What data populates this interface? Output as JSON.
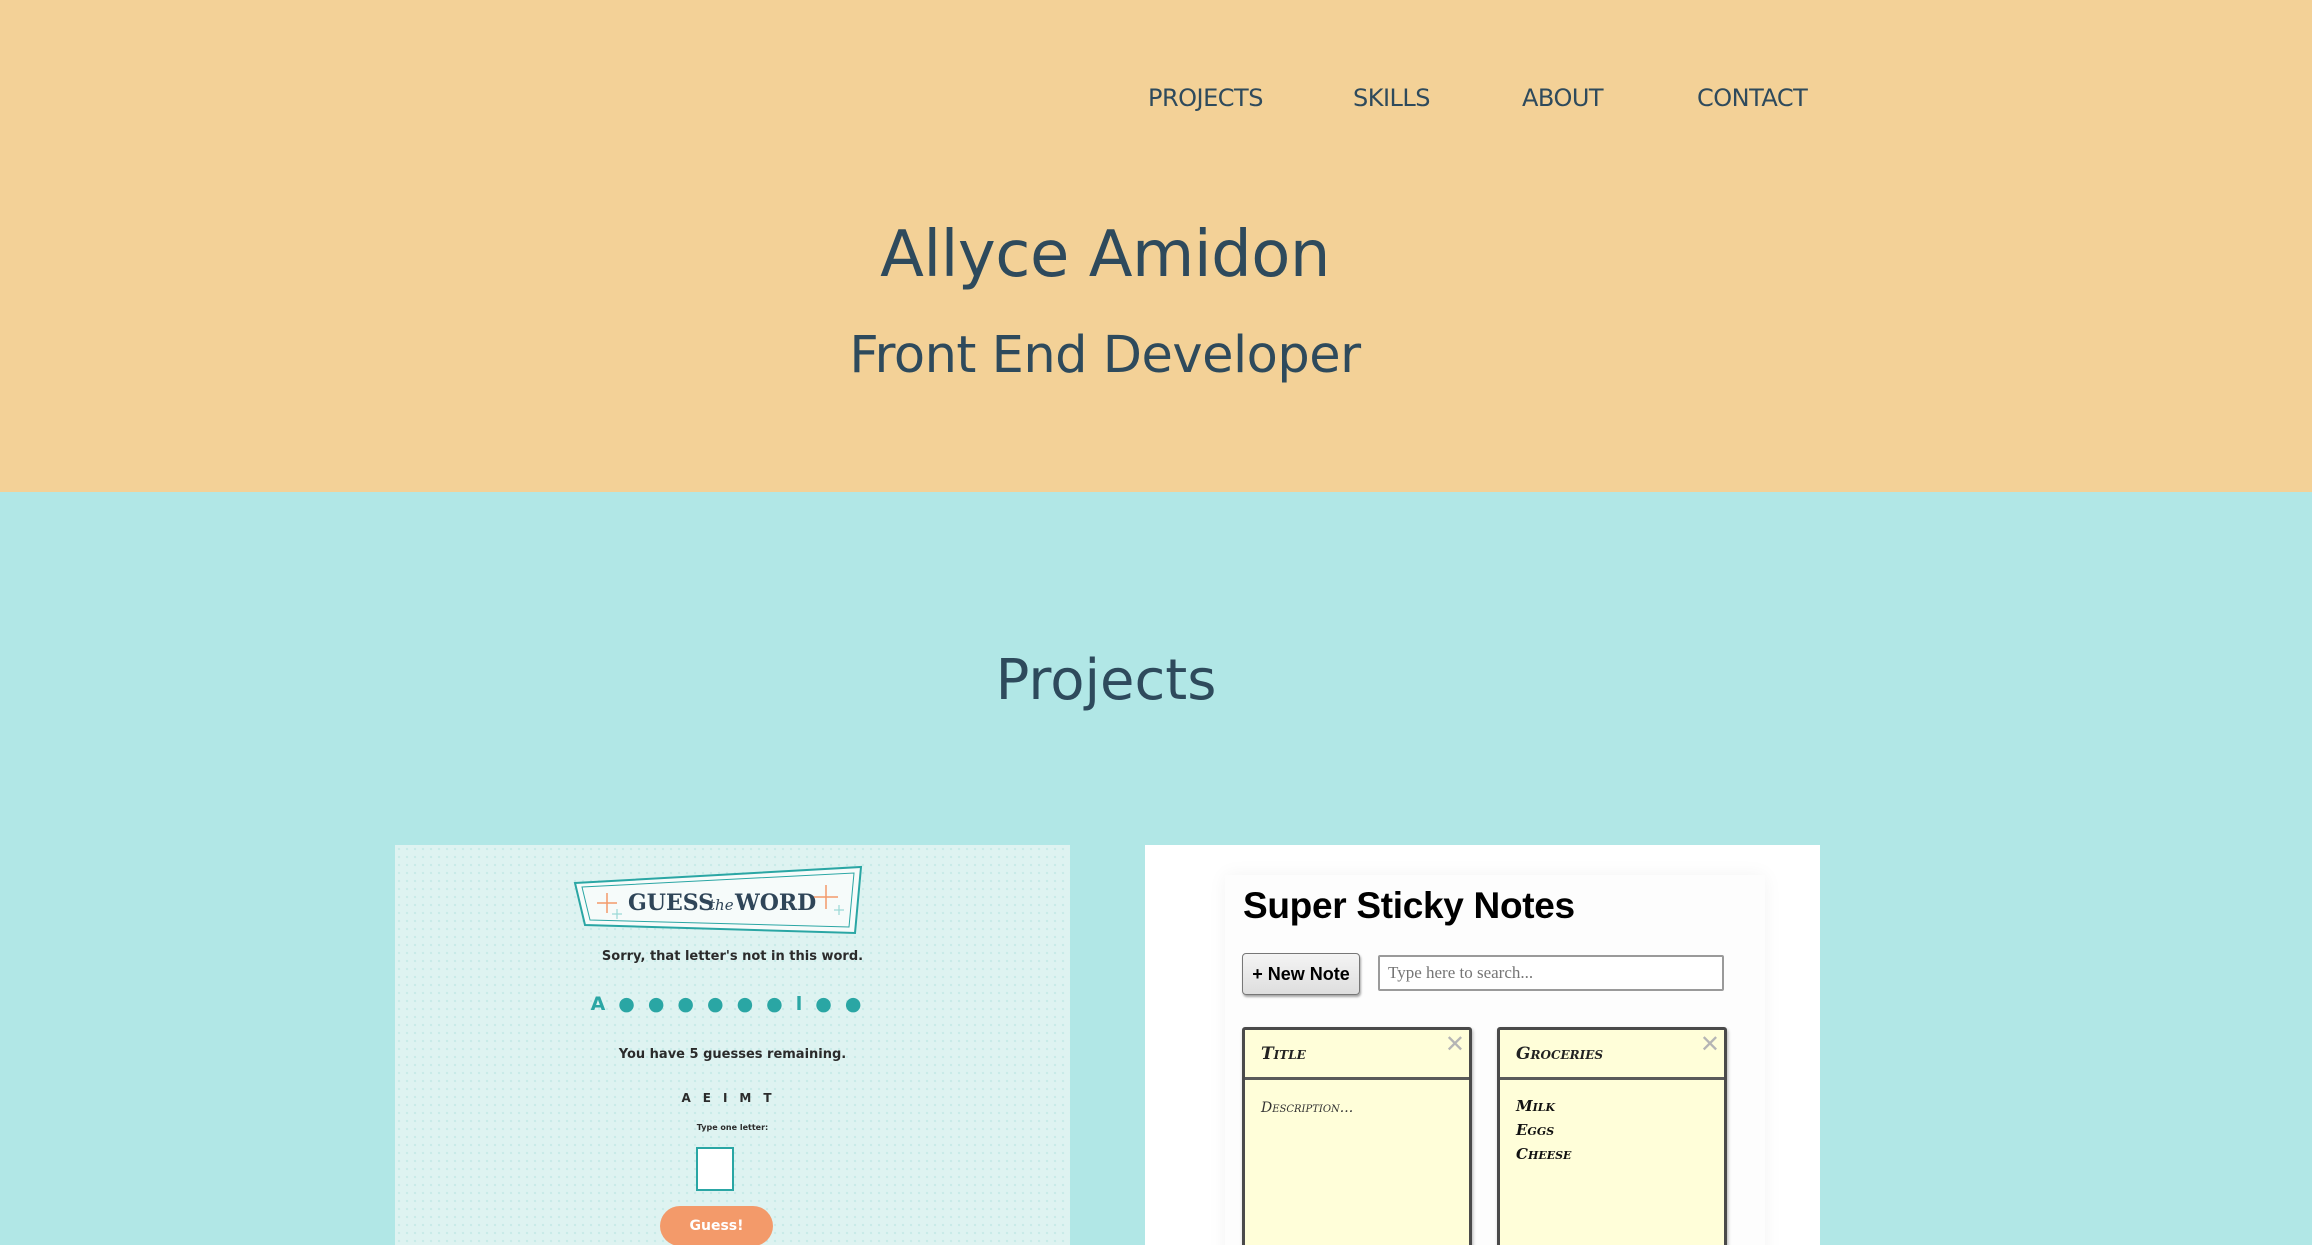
{
  "nav": {
    "items": [
      {
        "label": "PROJECTS"
      },
      {
        "label": "SKILLS"
      },
      {
        "label": "ABOUT"
      },
      {
        "label": "CONTACT"
      }
    ]
  },
  "hero": {
    "name": "Allyce Amidon",
    "title": "Front End Developer"
  },
  "projects": {
    "heading": "Projects",
    "guess_the_word": {
      "logo_word_1": "GUESS",
      "logo_word_2": "the",
      "logo_word_3": "WORD",
      "message": "Sorry, that letter's not in this word.",
      "word_progress": "A●●●●●●l●●",
      "remaining": "You have 5 guesses remaining.",
      "guessed_letters": "AEIMT",
      "input_prompt": "Type one letter:",
      "button_label": "Guess!"
    },
    "sticky_notes": {
      "title": "Super Sticky Notes",
      "new_note_label": "+ New Note",
      "search_placeholder": "Type here to search...",
      "notes": [
        {
          "title": "Title",
          "body": "Description...",
          "items": []
        },
        {
          "title": "Groceries",
          "body": "",
          "items": [
            "Milk",
            "Eggs",
            "Cheese"
          ]
        }
      ]
    }
  },
  "colors": {
    "header_bg": "#f3d197",
    "projects_bg": "#b1e7e6",
    "text": "#2e4a5c",
    "accent_teal": "#2aa6a4",
    "accent_coral": "#f39a6a",
    "sticky_yellow": "#fffed9"
  }
}
